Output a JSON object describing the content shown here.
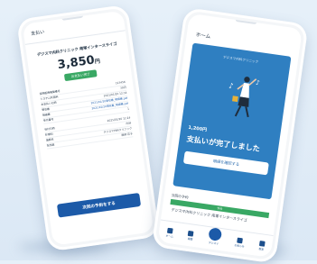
{
  "payment_screen": {
    "title": "支払い",
    "clinic_name": "デジスマ内科クリニック 南塚インタースライゴ",
    "amount": "3,850",
    "currency": "円",
    "status_badge": "お支払い完了",
    "rows": [
      {
        "label": "保険医療機関番号",
        "value": "123456"
      },
      {
        "label": "システム利用料",
        "value": "30円"
      },
      {
        "label": "お支払い日時",
        "value": "2021/01/20 12:34"
      },
      {
        "label": "領収書",
        "value": "2021/01/20領収書_明細書.pdf"
      },
      {
        "label": "明細書",
        "value": "2021/01/20領収書_明細書.pdf"
      },
      {
        "label": "受付番号",
        "value": "1"
      }
    ],
    "rows2": [
      {
        "label": "受付日時",
        "value": "2021/01/20 11:24"
      },
      {
        "label": "診療科",
        "value": "内科"
      },
      {
        "label": "施設名",
        "value": "デジスマ内科クリニック"
      },
      {
        "label": "担当医",
        "value": "医師 花子"
      }
    ],
    "next_button": "次回の予約をする"
  },
  "home_screen": {
    "title": "ホーム",
    "clinic_name": "デジスマ内科クリニック",
    "amount": "1,200円",
    "message": "支払いが完了しました",
    "receipt_button": "明細を確認する",
    "next_label": "次回の予約",
    "next_status": "予約",
    "next_clinic": "デジスマ内科クリニック 南塚インタースライゴ",
    "tabs": [
      "ホーム",
      "履歴",
      "デジスマ",
      "お知らせ",
      "設定"
    ]
  }
}
